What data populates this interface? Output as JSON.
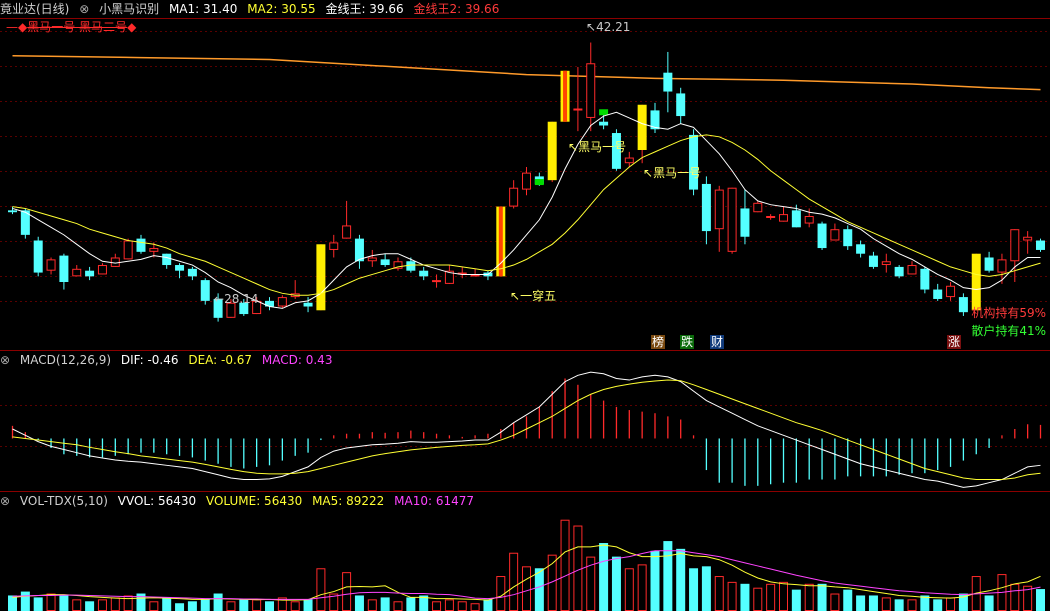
{
  "colors": {
    "bg": "#000000",
    "panel_border": "#8b0000",
    "grid": "#5a0000",
    "up": "#ff2a2a",
    "down": "#54ffff",
    "ma1": "#ffffff",
    "ma2": "#ffff33",
    "gold_line": "#ff9a2a",
    "highlight": "#ffee00",
    "highlight_edge": "#ff4400",
    "green_mark": "#00dd00",
    "magenta": "#ff44ff",
    "annot": "#ffff66",
    "text": "#c8c8c8"
  },
  "header": {
    "stock": "竟业达(日线)",
    "indicator": "小黑马识别",
    "ma1": "MA1: 31.40",
    "ma2": "MA2: 30.55",
    "gold1": "金线王: 39.66",
    "gold2": "金线王2: 39.66"
  },
  "main_legend": "黑马一号 黑马二号",
  "annotations": {
    "high": "42.21",
    "low": "28.14",
    "yichuanwu": "一穿五",
    "heima1": "黑马一号",
    "heima2": "黑马一号"
  },
  "markers": {
    "bang": "榜",
    "die": "跌",
    "cai": "财",
    "zhang": "涨"
  },
  "holdings": {
    "inst": "机构持有59%",
    "retail": "散户持有41%"
  },
  "macd_header": {
    "name": "MACD(12,26,9)",
    "dif": "DIF: -0.46",
    "dea": "DEA: -0.67",
    "macd": "MACD: 0.43"
  },
  "vol_header": {
    "name": "VOL-TDX(5,10)",
    "vvol": "VVOL: 56430",
    "volume": "VOLUME: 56430",
    "ma5": "MA5: 89222",
    "ma10": "MA10: 61477"
  },
  "chart_data": {
    "type": "candlestick",
    "price_range": [
      26.0,
      43.5
    ],
    "candles": [
      [
        33.3,
        33.5,
        33.1,
        33.2
      ],
      [
        33.3,
        33.4,
        31.8,
        32.0
      ],
      [
        31.7,
        31.9,
        29.8,
        30.0
      ],
      [
        30.1,
        30.8,
        29.9,
        30.7
      ],
      [
        30.9,
        31.0,
        29.1,
        29.5
      ],
      [
        29.8,
        30.4,
        29.8,
        30.2
      ],
      [
        30.1,
        30.3,
        29.6,
        29.8
      ],
      [
        29.9,
        30.5,
        29.9,
        30.4
      ],
      [
        30.3,
        31.0,
        30.3,
        30.8
      ],
      [
        30.7,
        31.8,
        30.7,
        31.7
      ],
      [
        31.8,
        32.0,
        31.0,
        31.1
      ],
      [
        31.1,
        31.6,
        30.8,
        31.3
      ],
      [
        31.0,
        31.0,
        30.2,
        30.4
      ],
      [
        30.4,
        30.5,
        29.7,
        30.1
      ],
      [
        30.2,
        30.3,
        29.6,
        29.8
      ],
      [
        29.6,
        29.7,
        28.3,
        28.5
      ],
      [
        28.6,
        28.9,
        27.4,
        27.6
      ],
      [
        27.6,
        28.6,
        27.6,
        28.4
      ],
      [
        28.4,
        28.6,
        27.7,
        27.8
      ],
      [
        27.8,
        28.7,
        27.8,
        28.5
      ],
      [
        28.5,
        28.7,
        28.0,
        28.2
      ],
      [
        28.2,
        28.8,
        28.1,
        28.7
      ],
      [
        28.7,
        29.6,
        28.6,
        28.9
      ],
      [
        28.4,
        28.7,
        27.9,
        28.2
      ],
      [
        28.0,
        31.5,
        28.0,
        31.5
      ],
      [
        31.2,
        32.0,
        30.8,
        31.6
      ],
      [
        31.8,
        33.8,
        31.8,
        32.5
      ],
      [
        31.8,
        32.0,
        30.2,
        30.6
      ],
      [
        30.6,
        31.2,
        30.3,
        30.8
      ],
      [
        30.7,
        31.0,
        30.3,
        30.4
      ],
      [
        30.2,
        30.8,
        30.1,
        30.6
      ],
      [
        30.6,
        30.8,
        30.0,
        30.1
      ],
      [
        30.1,
        30.3,
        29.6,
        29.8
      ],
      [
        29.5,
        29.9,
        29.2,
        29.6
      ],
      [
        29.4,
        30.4,
        29.4,
        30.1
      ],
      [
        30.0,
        30.3,
        29.7,
        30.0
      ],
      [
        29.9,
        30.2,
        29.8,
        29.9
      ],
      [
        30.0,
        30.1,
        29.6,
        29.8
      ],
      [
        29.8,
        33.5,
        29.8,
        33.5
      ],
      [
        33.5,
        34.9,
        33.4,
        34.5
      ],
      [
        34.4,
        35.6,
        34.1,
        35.3
      ],
      [
        35.1,
        35.3,
        34.6,
        34.7
      ],
      [
        34.9,
        38.0,
        34.8,
        38.0
      ],
      [
        38.0,
        40.7,
        38.0,
        40.7
      ],
      [
        38.6,
        40.9,
        37.5,
        38.7
      ],
      [
        38.2,
        42.2,
        37.5,
        41.1
      ],
      [
        38.0,
        38.5,
        37.6,
        37.8
      ],
      [
        37.4,
        37.6,
        35.4,
        35.5
      ],
      [
        35.8,
        36.4,
        35.6,
        36.1
      ],
      [
        36.5,
        38.9,
        35.8,
        38.9
      ],
      [
        38.6,
        39.0,
        37.4,
        37.6
      ],
      [
        40.6,
        41.7,
        38.5,
        39.6
      ],
      [
        39.5,
        39.8,
        37.9,
        38.3
      ],
      [
        37.3,
        37.6,
        34.1,
        34.4
      ],
      [
        34.7,
        35.1,
        31.5,
        32.2
      ],
      [
        32.3,
        34.6,
        31.1,
        34.4
      ],
      [
        31.1,
        34.5,
        31.0,
        34.5
      ],
      [
        33.4,
        34.4,
        31.5,
        31.9
      ],
      [
        33.2,
        33.8,
        33.2,
        33.7
      ],
      [
        32.9,
        33.1,
        32.8,
        33.0
      ],
      [
        32.7,
        33.5,
        32.7,
        33.1
      ],
      [
        33.3,
        33.6,
        32.4,
        32.4
      ],
      [
        32.6,
        33.4,
        32.4,
        33.0
      ],
      [
        32.6,
        32.7,
        31.2,
        31.3
      ],
      [
        31.7,
        32.6,
        31.7,
        32.3
      ],
      [
        32.3,
        32.5,
        31.2,
        31.4
      ],
      [
        31.5,
        31.7,
        30.8,
        31.0
      ],
      [
        30.9,
        31.1,
        30.2,
        30.3
      ],
      [
        30.4,
        31.0,
        30.0,
        30.6
      ],
      [
        30.3,
        30.4,
        29.7,
        29.8
      ],
      [
        29.9,
        30.6,
        29.9,
        30.4
      ],
      [
        30.2,
        30.3,
        28.9,
        29.1
      ],
      [
        29.1,
        29.4,
        28.5,
        28.6
      ],
      [
        28.7,
        29.5,
        28.5,
        29.3
      ],
      [
        28.7,
        28.9,
        27.7,
        27.9
      ],
      [
        28.0,
        31.0,
        28.0,
        31.0
      ],
      [
        30.8,
        31.1,
        30.0,
        30.1
      ],
      [
        30.0,
        31.0,
        29.4,
        30.7
      ],
      [
        30.6,
        32.3,
        29.5,
        32.3
      ],
      [
        31.7,
        32.2,
        31.0,
        31.9
      ],
      [
        31.7,
        31.8,
        31.1,
        31.2
      ]
    ],
    "highlight_bars": [
      {
        "index": 24,
        "type": "plain"
      },
      {
        "index": 38,
        "type": "edge"
      },
      {
        "index": 42,
        "type": "plain"
      },
      {
        "index": 43,
        "type": "edge"
      },
      {
        "index": 49,
        "type": "plain"
      },
      {
        "index": 75,
        "type": "plain"
      }
    ],
    "green_marks": [
      {
        "index": 41,
        "price": 34.8
      },
      {
        "index": 46,
        "price": 38.5
      }
    ],
    "ma1": [
      33.4,
      33.2,
      32.8,
      32.4,
      32.0,
      31.5,
      31.0,
      30.6,
      30.5,
      30.6,
      30.7,
      30.9,
      30.8,
      30.6,
      30.4,
      30.0,
      29.5,
      29.2,
      28.8,
      28.5,
      28.2,
      28.1,
      28.4,
      28.5,
      28.9,
      29.6,
      30.3,
      30.7,
      30.9,
      31.0,
      31.0,
      30.7,
      30.4,
      30.2,
      30.0,
      29.9,
      29.9,
      29.9,
      30.5,
      31.2,
      32.0,
      32.8,
      34.0,
      35.5,
      36.8,
      37.8,
      38.3,
      38.5,
      38.2,
      37.9,
      37.7,
      37.6,
      37.9,
      37.7,
      37.0,
      36.3,
      35.4,
      34.4,
      33.8,
      33.6,
      33.5,
      33.4,
      33.2,
      33.1,
      32.9,
      32.6,
      32.3,
      31.8,
      31.4,
      31.0,
      30.7,
      30.3,
      29.9,
      29.6,
      29.2,
      29.1,
      29.2,
      29.6,
      30.3,
      30.8,
      30.8
    ],
    "ma2": [
      33.5,
      33.4,
      33.2,
      33.0,
      32.8,
      32.6,
      32.3,
      32.1,
      31.9,
      31.7,
      31.6,
      31.5,
      31.3,
      31.0,
      30.8,
      30.6,
      30.3,
      30.0,
      29.7,
      29.4,
      29.1,
      28.9,
      28.8,
      28.8,
      28.9,
      29.1,
      29.4,
      29.7,
      29.9,
      30.1,
      30.3,
      30.4,
      30.4,
      30.4,
      30.4,
      30.3,
      30.2,
      30.1,
      30.2,
      30.4,
      30.7,
      31.1,
      31.5,
      32.1,
      32.8,
      33.6,
      34.4,
      35.0,
      35.6,
      36.1,
      36.4,
      36.7,
      37.0,
      37.2,
      37.3,
      37.2,
      36.9,
      36.5,
      36.0,
      35.4,
      34.9,
      34.4,
      33.9,
      33.5,
      33.1,
      32.7,
      32.4,
      32.1,
      31.8,
      31.5,
      31.2,
      30.9,
      30.6,
      30.3,
      30.1,
      29.9,
      29.8,
      29.9,
      30.1,
      30.3,
      30.5
    ],
    "gold_line": [
      [
        0,
        41.5
      ],
      [
        10,
        41.4
      ],
      [
        20,
        41.3
      ],
      [
        30,
        40.9
      ],
      [
        40,
        40.5
      ],
      [
        50,
        40.3
      ],
      [
        55,
        40.25
      ],
      [
        60,
        40.2
      ],
      [
        70,
        40.0
      ],
      [
        76,
        39.8
      ],
      [
        80,
        39.7
      ]
    ],
    "macd": {
      "range": [
        -1.6,
        2.2
      ],
      "hist": [
        0.4,
        0.2,
        -0.05,
        -0.3,
        -0.5,
        -0.55,
        -0.6,
        -0.6,
        -0.55,
        -0.5,
        -0.45,
        -0.45,
        -0.5,
        -0.55,
        -0.6,
        -0.7,
        -0.8,
        -0.9,
        -0.95,
        -0.9,
        -0.85,
        -0.7,
        -0.55,
        -0.45,
        -0.05,
        0.1,
        0.15,
        0.15,
        0.2,
        0.18,
        0.2,
        0.25,
        0.2,
        0.15,
        0.1,
        0.05,
        0.1,
        0.15,
        0.3,
        0.5,
        0.7,
        1.0,
        1.5,
        1.9,
        1.7,
        1.4,
        1.2,
        1.0,
        0.9,
        0.85,
        0.8,
        0.7,
        0.6,
        0.1,
        -1.0,
        -1.4,
        -1.4,
        -1.5,
        -1.5,
        -1.45,
        -1.4,
        -1.4,
        -1.3,
        -1.3,
        -1.3,
        -1.2,
        -1.2,
        -1.2,
        -1.2,
        -1.15,
        -1.1,
        -1.1,
        -1.0,
        -0.9,
        -0.7,
        -0.5,
        -0.3,
        0.1,
        0.3,
        0.45,
        0.43
      ],
      "dif": [
        0.3,
        0.1,
        -0.1,
        -0.25,
        -0.35,
        -0.45,
        -0.55,
        -0.62,
        -0.68,
        -0.72,
        -0.75,
        -0.8,
        -0.85,
        -0.9,
        -0.95,
        -1.05,
        -1.15,
        -1.25,
        -1.3,
        -1.3,
        -1.28,
        -1.2,
        -1.05,
        -0.9,
        -0.6,
        -0.4,
        -0.3,
        -0.25,
        -0.2,
        -0.18,
        -0.15,
        -0.1,
        -0.12,
        -0.12,
        -0.1,
        -0.08,
        -0.05,
        -0.05,
        0.2,
        0.5,
        0.75,
        1.0,
        1.4,
        1.8,
        2.0,
        2.1,
        2.05,
        1.9,
        1.85,
        1.95,
        2.0,
        1.95,
        1.8,
        1.5,
        1.2,
        1.0,
        0.8,
        0.6,
        0.4,
        0.25,
        0.1,
        -0.05,
        -0.2,
        -0.35,
        -0.5,
        -0.65,
        -0.8,
        -0.9,
        -1.0,
        -1.1,
        -1.2,
        -1.3,
        -1.35,
        -1.45,
        -1.55,
        -1.5,
        -1.4,
        -1.3,
        -1.1,
        -0.9,
        -0.85
      ],
      "dea": [
        0.05,
        0.0,
        -0.05,
        -0.1,
        -0.15,
        -0.2,
        -0.28,
        -0.35,
        -0.42,
        -0.48,
        -0.55,
        -0.6,
        -0.65,
        -0.7,
        -0.75,
        -0.82,
        -0.9,
        -0.98,
        -1.05,
        -1.1,
        -1.12,
        -1.12,
        -1.1,
        -1.05,
        -0.95,
        -0.85,
        -0.75,
        -0.65,
        -0.55,
        -0.48,
        -0.42,
        -0.36,
        -0.32,
        -0.28,
        -0.25,
        -0.22,
        -0.2,
        -0.17,
        -0.05,
        0.1,
        0.3,
        0.5,
        0.7,
        0.95,
        1.2,
        1.4,
        1.55,
        1.65,
        1.72,
        1.78,
        1.82,
        1.85,
        1.83,
        1.7,
        1.55,
        1.4,
        1.25,
        1.1,
        0.95,
        0.8,
        0.65,
        0.5,
        0.38,
        0.25,
        0.1,
        -0.05,
        -0.2,
        -0.35,
        -0.5,
        -0.65,
        -0.8,
        -0.95,
        -1.05,
        -1.15,
        -1.25,
        -1.3,
        -1.3,
        -1.3,
        -1.25,
        -1.15,
        -1.1
      ]
    },
    "volume": {
      "range": [
        0,
        260000
      ],
      "bars": [
        40000,
        50000,
        35000,
        45000,
        40000,
        30000,
        25000,
        30000,
        35000,
        40000,
        45000,
        25000,
        35000,
        20000,
        25000,
        30000,
        45000,
        25000,
        30000,
        30000,
        25000,
        35000,
        25000,
        30000,
        110000,
        45000,
        100000,
        40000,
        30000,
        35000,
        25000,
        35000,
        40000,
        25000,
        30000,
        25000,
        20000,
        30000,
        90000,
        150000,
        115000,
        110000,
        145000,
        235000,
        220000,
        140000,
        175000,
        140000,
        110000,
        120000,
        155000,
        180000,
        160000,
        110000,
        115000,
        90000,
        75000,
        70000,
        60000,
        70000,
        75000,
        55000,
        70000,
        70000,
        45000,
        55000,
        40000,
        40000,
        35000,
        30000,
        30000,
        40000,
        30000,
        35000,
        45000,
        90000,
        40000,
        95000,
        70000,
        65000,
        56430
      ],
      "ma5": [
        35000,
        38000,
        40000,
        42000,
        42000,
        40000,
        37000,
        35000,
        33000,
        32000,
        33000,
        34000,
        33000,
        32000,
        30000,
        30000,
        32000,
        31000,
        30000,
        29000,
        30000,
        28000,
        28000,
        29000,
        42000,
        50000,
        62000,
        63000,
        62000,
        65000,
        48000,
        35000,
        35000,
        32000,
        32000,
        31000,
        30000,
        28000,
        38000,
        62000,
        82000,
        100000,
        122000,
        152000,
        165000,
        165000,
        170000,
        165000,
        150000,
        140000,
        140000,
        142000,
        148000,
        142000,
        140000,
        132000,
        118000,
        100000,
        85000,
        75000,
        70000,
        68000,
        65000,
        65000,
        62000,
        60000,
        55000,
        50000,
        45000,
        40000,
        38000,
        35000,
        34000,
        33000,
        36000,
        46000,
        52000,
        60000,
        70000,
        75000,
        89222
      ],
      "ma10": [
        38000,
        39000,
        40000,
        40000,
        41000,
        41000,
        40000,
        39000,
        38000,
        37000,
        37000,
        36000,
        35000,
        34000,
        33000,
        32000,
        32000,
        32000,
        31000,
        31000,
        30000,
        30000,
        30000,
        30000,
        34000,
        38000,
        43000,
        47000,
        48000,
        48000,
        46000,
        45000,
        45000,
        43000,
        42000,
        38000,
        33000,
        32000,
        35000,
        42000,
        52000,
        62000,
        75000,
        90000,
        105000,
        118000,
        128000,
        135000,
        140000,
        148000,
        155000,
        155000,
        155000,
        150000,
        145000,
        140000,
        132000,
        124000,
        116000,
        108000,
        100000,
        92000,
        85000,
        78000,
        72000,
        68000,
        64000,
        60000,
        56000,
        52000,
        50000,
        47000,
        45000,
        43000,
        42000,
        44000,
        46000,
        48000,
        52000,
        55000,
        61477
      ]
    }
  }
}
